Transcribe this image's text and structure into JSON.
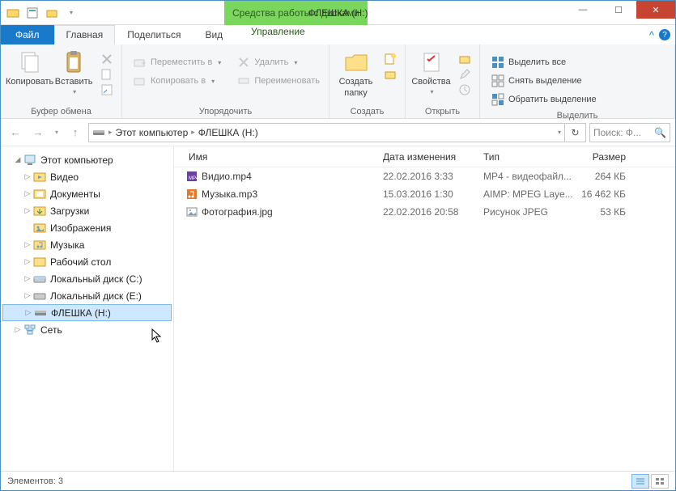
{
  "window": {
    "title": "ФЛЕШКА (H:)",
    "context_tab": "Средства работы с дисками"
  },
  "tabs": {
    "file": "Файл",
    "home": "Главная",
    "share": "Поделиться",
    "view": "Вид",
    "manage": "Управление"
  },
  "ribbon": {
    "clipboard": {
      "copy": "Копировать",
      "paste": "Вставить",
      "label": "Буфер обмена"
    },
    "organize": {
      "move": "Переместить в",
      "copyto": "Копировать в",
      "delete": "Удалить",
      "rename": "Переименовать",
      "label": "Упорядочить"
    },
    "new": {
      "newfolder1": "Создать",
      "newfolder2": "папку",
      "label": "Создать"
    },
    "open": {
      "props": "Свойства",
      "label": "Открыть"
    },
    "select": {
      "all": "Выделить все",
      "none": "Снять выделение",
      "invert": "Обратить выделение",
      "label": "Выделить"
    }
  },
  "breadcrumbs": {
    "root": "Этот компьютер",
    "leaf": "ФЛЕШКА (H:)"
  },
  "search_placeholder": "Поиск: Ф...",
  "tree": {
    "this_pc": "Этот компьютер",
    "items": [
      "Видео",
      "Документы",
      "Загрузки",
      "Изображения",
      "Музыка",
      "Рабочий стол",
      "Локальный диск (C:)",
      "Локальный диск (E:)",
      "ФЛЕШКА (H:)"
    ],
    "network": "Сеть"
  },
  "columns": {
    "name": "Имя",
    "date": "Дата изменения",
    "type": "Тип",
    "size": "Размер"
  },
  "files": [
    {
      "name": "Видио.mp4",
      "date": "22.02.2016 3:33",
      "type": "MP4 - видеофайл...",
      "size": "264 КБ"
    },
    {
      "name": "Музыка.mp3",
      "date": "15.03.2016 1:30",
      "type": "AIMP: MPEG Laye...",
      "size": "16 462 КБ"
    },
    {
      "name": "Фотография.jpg",
      "date": "22.02.2016 20:58",
      "type": "Рисунок JPEG",
      "size": "53 КБ"
    }
  ],
  "status": "Элементов: 3"
}
